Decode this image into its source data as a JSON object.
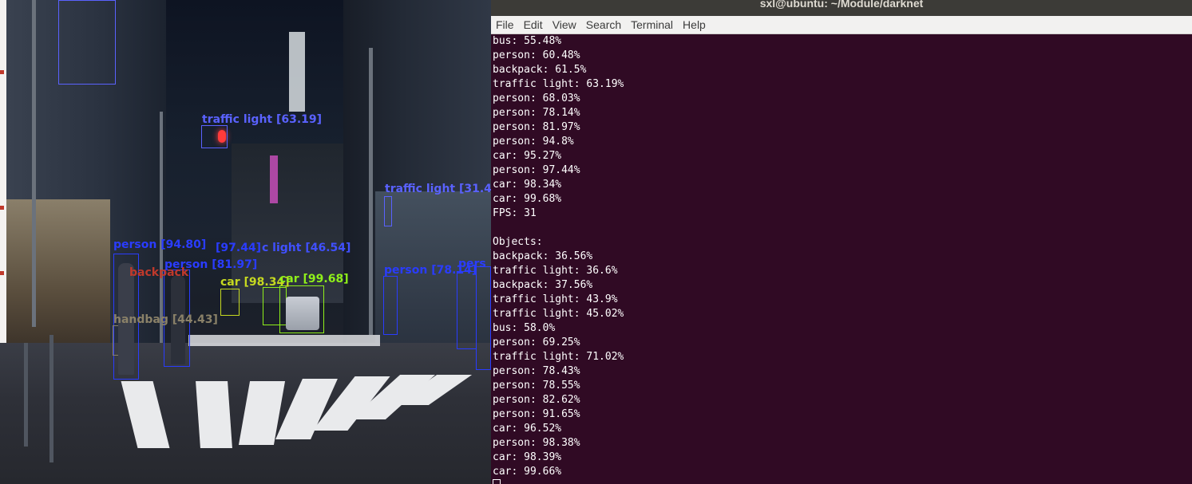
{
  "window": {
    "title": "sxl@ubuntu: ~/Module/darknet",
    "menu": [
      "File",
      "Edit",
      "View",
      "Search",
      "Terminal",
      "Help"
    ]
  },
  "terminal_output": [
    "bus: 55.48%",
    "person: 60.48%",
    "backpack: 61.5%",
    "traffic light: 63.19%",
    "person: 68.03%",
    "person: 78.14%",
    "person: 81.97%",
    "person: 94.8%",
    "car: 95.27%",
    "person: 97.44%",
    "car: 98.34%",
    "car: 99.68%",
    "FPS: 31",
    "",
    "Objects:",
    "backpack: 36.56%",
    "traffic light: 36.6%",
    "backpack: 37.56%",
    "traffic light: 43.9%",
    "traffic light: 45.02%",
    "bus: 58.0%",
    "person: 69.25%",
    "traffic light: 71.02%",
    "person: 78.43%",
    "person: 78.55%",
    "person: 82.62%",
    "person: 91.65%",
    "car: 96.52%",
    "person: 98.38%",
    "car: 98.39%",
    "car: 99.66%"
  ],
  "detections": [
    {
      "label": "traffic light [63.19]",
      "color": "#5a62ff"
    },
    {
      "label": "traffic light [31.4",
      "color": "#5a62ff"
    },
    {
      "label": "c light [46.54]",
      "color": "#4050ff"
    },
    {
      "label": "person [94.80]",
      "color": "#2a3cff"
    },
    {
      "label": "[97.44]",
      "color": "#2a3cff"
    },
    {
      "label": "person [81.97]",
      "color": "#2a3cff"
    },
    {
      "label": "backpack",
      "color": "#c0392b"
    },
    {
      "label": "car [98.34]",
      "color": "#8fef1a"
    },
    {
      "label": "car [99.68]",
      "color": "#8fef1a"
    },
    {
      "label": "handbag [44.43]",
      "color": "#8a8168"
    },
    {
      "label": "person [78.14]",
      "color": "#2a3cff"
    },
    {
      "label": "pers",
      "color": "#2a3cff"
    }
  ],
  "colors": {
    "terminal_bg": "#300a24",
    "terminal_fg": "#ffffff",
    "titlebar_bg": "#3c3b37",
    "menubar_bg": "#f2f1f0"
  }
}
